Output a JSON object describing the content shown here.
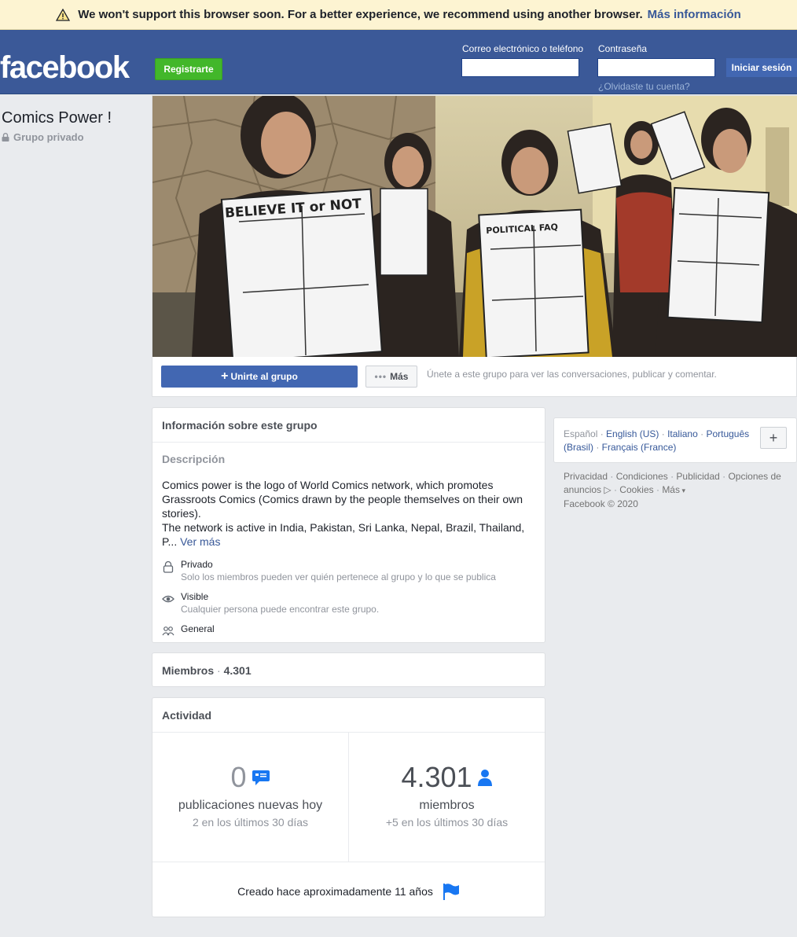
{
  "banner": {
    "message": "We won't support this browser soon. For a better experience, we recommend using another browser.",
    "link": "Más información"
  },
  "header": {
    "logo": "facebook",
    "register": "Registrarte",
    "email_label": "Correo electrónico o teléfono",
    "password_label": "Contraseña",
    "login": "Iniciar sesión",
    "forgot": "¿Olvidaste tu cuenta?"
  },
  "group": {
    "name": "Comics Power !",
    "privacy": "Grupo privado"
  },
  "cover": {
    "join": "Unirte al grupo",
    "more": "Más",
    "hint": "Únete a este grupo para ver las conversaciones, publicar y comentar.",
    "panel_titles": [
      "BELIEVE IT or NOT",
      "POLITICAL FAQ"
    ]
  },
  "about": {
    "title": "Información sobre este grupo",
    "desc_label": "Descripción",
    "desc_line1": "Comics power is the logo of World Comics network, which promotes Grassroots Comics (Comics drawn by the people themselves on their own stories).",
    "desc_line2": "The network is active in India, Pakistan, Sri Lanka, Nepal, Brazil, Thailand, P...",
    "see_more": "Ver más",
    "private_title": "Privado",
    "private_sub": "Solo los miembros pueden ver quién pertenece al grupo y lo que se publica",
    "visible_title": "Visible",
    "visible_sub": "Cualquier persona puede encontrar este grupo.",
    "general": "General"
  },
  "members": {
    "title": "Miembros",
    "count": "4.301"
  },
  "activity": {
    "title": "Actividad",
    "posts_num": "0",
    "posts_label": "publicaciones nuevas hoy",
    "posts_sub": "2 en los últimos 30 días",
    "members_num": "4.301",
    "members_label": "miembros",
    "members_sub": "+5 en los últimos 30 días",
    "created": "Creado hace aproximadamente 11 años"
  },
  "languages": {
    "current": "Español",
    "items": [
      "English (US)",
      "Italiano",
      "Português (Brasil)",
      "Français (France)"
    ],
    "add": "+"
  },
  "footer": {
    "links": [
      "Privacidad",
      "Condiciones",
      "Publicidad",
      "Opciones de anuncios",
      "Cookies",
      "Más"
    ],
    "copyright": "Facebook © 2020"
  },
  "colors": {
    "brand": "#3b5998",
    "button_blue": "#4267b2",
    "register_green": "#42b72a",
    "link": "#385898",
    "icon_blue": "#1877f2"
  }
}
